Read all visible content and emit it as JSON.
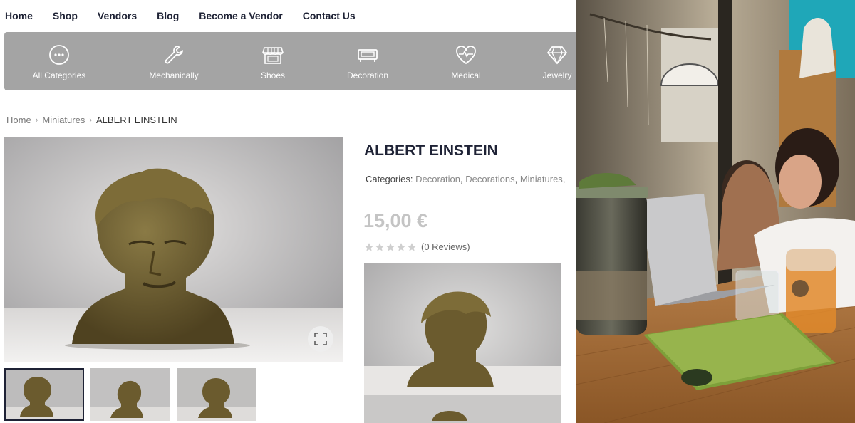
{
  "nav": [
    "Home",
    "Shop",
    "Vendors",
    "Blog",
    "Become a Vendor",
    "Contact Us"
  ],
  "categories": [
    {
      "label": "All Categories",
      "icon": "more-dots-icon"
    },
    {
      "label": "Mechanically",
      "icon": "wrench-icon"
    },
    {
      "label": "Shoes",
      "icon": "store-icon"
    },
    {
      "label": "Decoration",
      "icon": "sofa-icon"
    },
    {
      "label": "Medical",
      "icon": "heartbeat-icon"
    },
    {
      "label": "Jewelry",
      "icon": "diamond-icon"
    }
  ],
  "breadcrumb": {
    "home": "Home",
    "parent": "Miniatures",
    "current": "ALBERT EINSTEIN"
  },
  "product": {
    "title": "ALBERT EINSTEIN",
    "categories_label": "Categories:",
    "categories": [
      "Decoration",
      "Decorations",
      "Miniatures"
    ],
    "price": "15,00 €",
    "reviews": "(0 Reviews)",
    "rating": 0
  },
  "colors": {
    "nav_text": "#1e2235",
    "category_bar": "#a4a4a4",
    "price": "#c4c4c4",
    "bust": "#6b5b2e"
  }
}
